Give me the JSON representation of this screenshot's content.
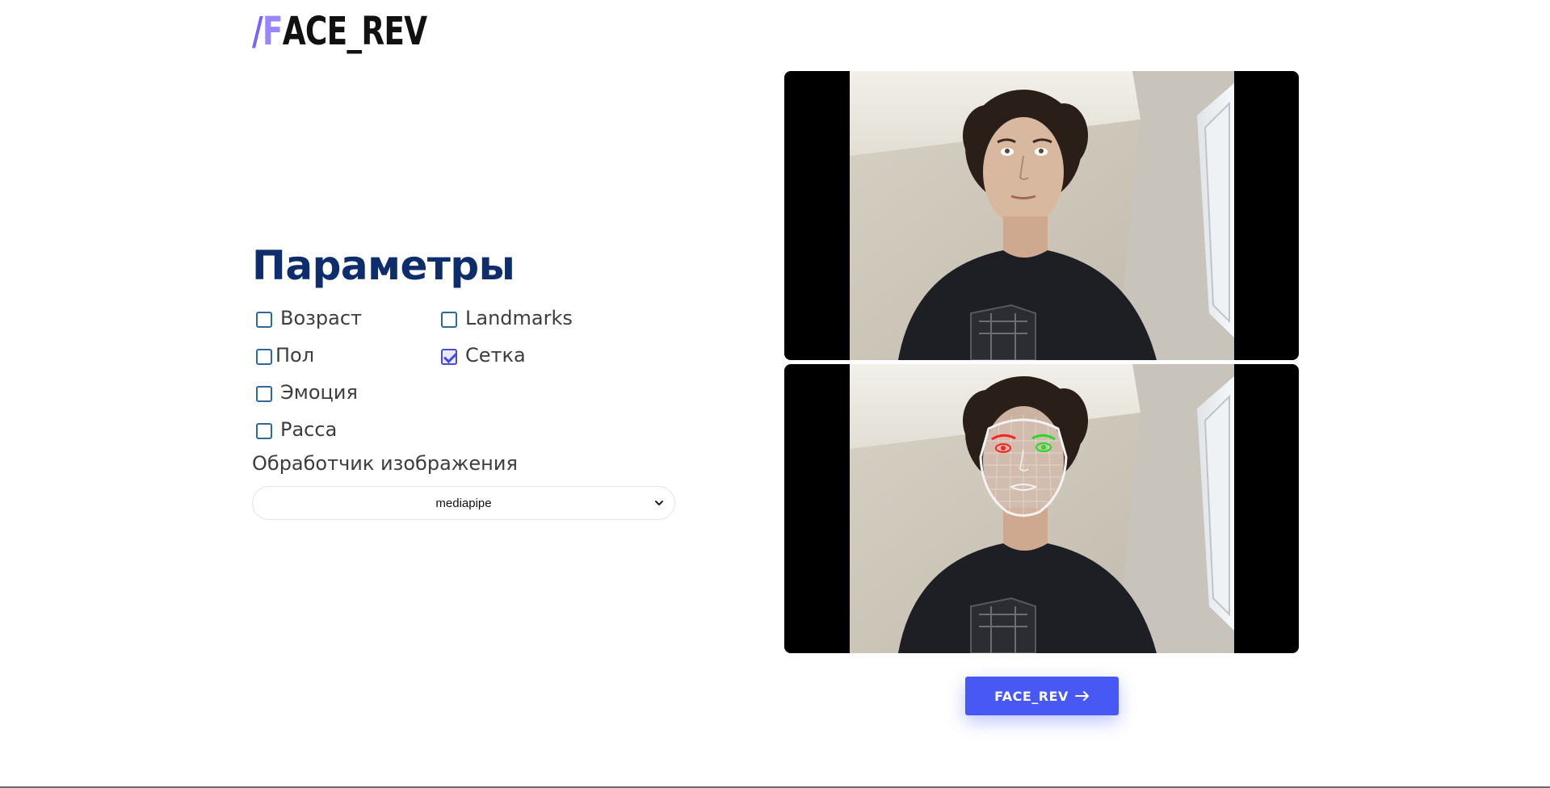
{
  "logo": {
    "slash": "/",
    "f": "F",
    "a": "A",
    "rest": "CE_REV",
    "accent_color": "#7b61ff"
  },
  "params": {
    "title": "Параметры",
    "options": [
      {
        "label": "Возраст",
        "checked": false
      },
      {
        "label": "Landmarks",
        "checked": false
      },
      {
        "label": "Пол",
        "checked": false
      },
      {
        "label": "Сетка",
        "checked": true
      },
      {
        "label": "Эмоция",
        "checked": false
      },
      {
        "label": "Расса",
        "checked": false
      }
    ],
    "handler_label": "Обработчик изображения",
    "handler_value": "mediapipe"
  },
  "video": {
    "original_frame": "webcam-frame",
    "processed_frame": "face-mesh-overlay",
    "mesh_color": "#ffffff",
    "left_eye_color": "#ff2020",
    "right_eye_color": "#22dd22"
  },
  "action": {
    "button_label": "FACE_REV"
  },
  "colors": {
    "title": "#0e2d6d",
    "button": "#4758f5",
    "checkbox_border": "#2a6b9c"
  }
}
